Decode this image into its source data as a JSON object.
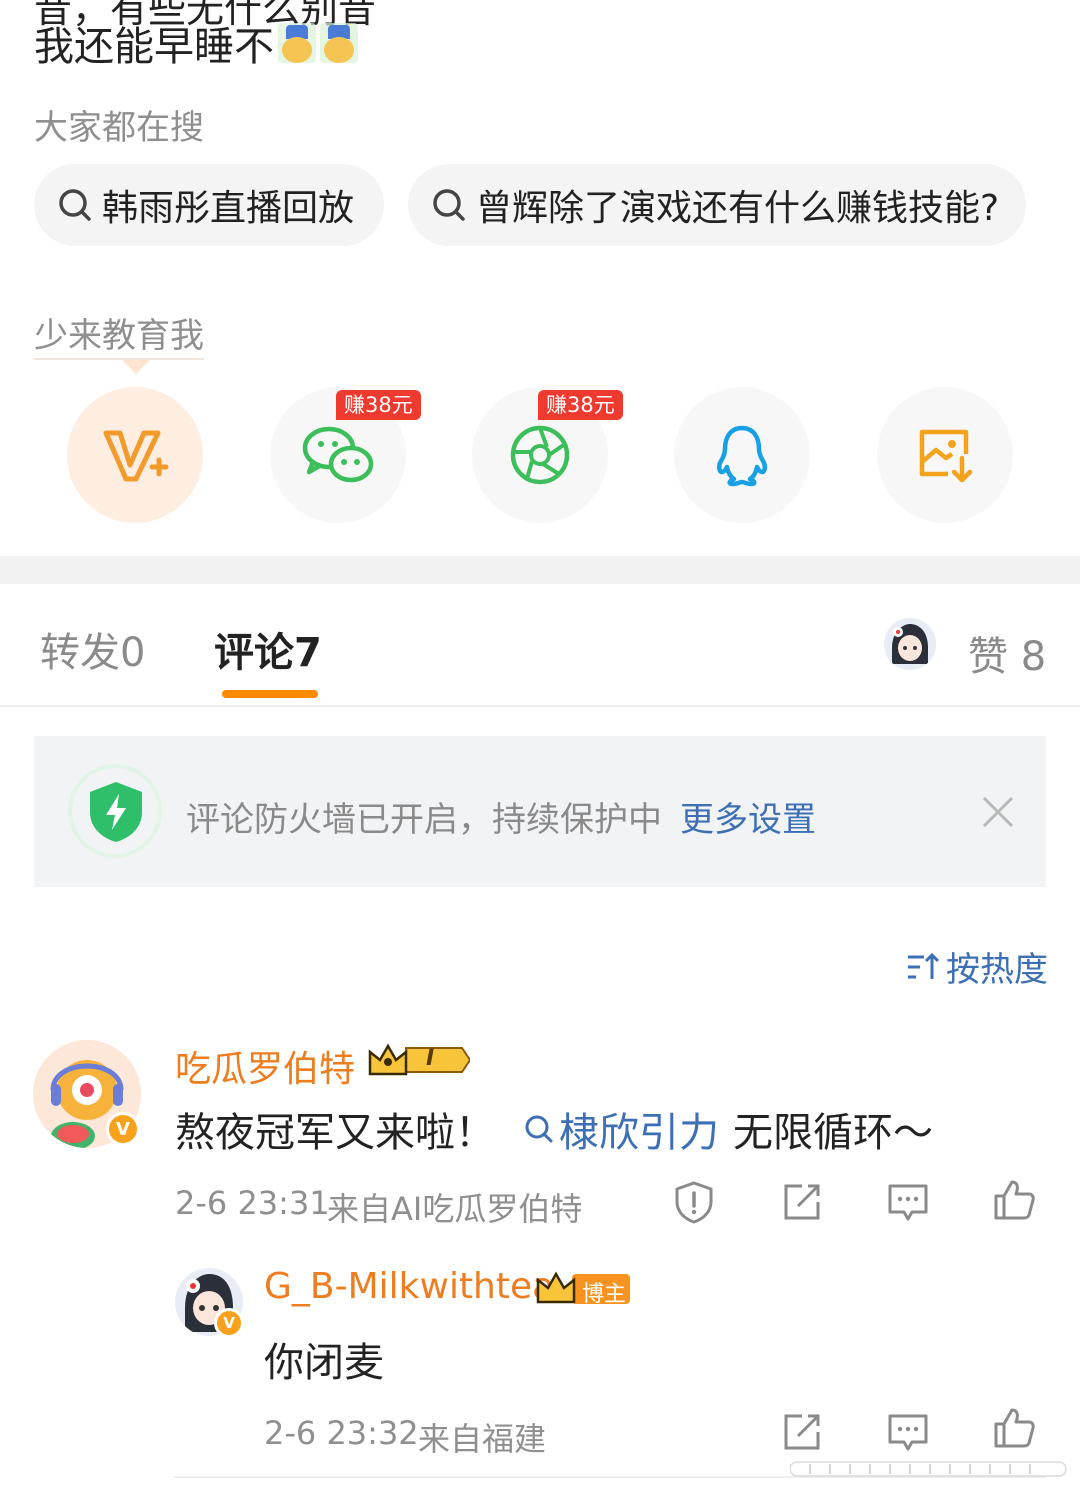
{
  "post": {
    "partial_line": "昔，有些无什么别昔",
    "line": "我还能早睡不"
  },
  "hot_search": {
    "label": "大家都在搜",
    "items": [
      "韩雨彤直播回放",
      "曾辉除了演戏还有什么赚钱技能?"
    ]
  },
  "share": {
    "label": "少来教育我",
    "earn_badge_1": "赚38元",
    "earn_badge_2": "赚38元",
    "icons": [
      "vplus-icon",
      "wechat-icon",
      "moments-icon",
      "qq-icon",
      "save-image-icon"
    ]
  },
  "tabs": {
    "repost": "转发",
    "repost_count": "0",
    "comment": "评论",
    "comment_count": "7",
    "like": "赞",
    "like_count": "8"
  },
  "firewall": {
    "text": "评论防火墙已开启，持续保护中",
    "link": "更多设置"
  },
  "sort": {
    "label": "按热度"
  },
  "comments": [
    {
      "user": "吃瓜罗伯特",
      "badge_text": "I",
      "text_before": "熬夜冠军又来啦！",
      "topic": "棣欣引力",
      "text_after": "无限循环～",
      "time": "2-6 23:31",
      "source": "来自AI吃瓜罗伯特"
    },
    {
      "user": "G_B-Milkwithtea",
      "badge_text": "博主",
      "text": "你闭麦",
      "time": "2-6 23:32",
      "source": "来自福建"
    }
  ],
  "colors": {
    "accent_orange": "#ff8a00",
    "link_blue": "#3d6fb5",
    "username_orange": "#ee7d1f",
    "earn_red": "#ef3a2f",
    "wechat_green": "#3cbf5a",
    "qq_blue": "#18a0e6"
  }
}
